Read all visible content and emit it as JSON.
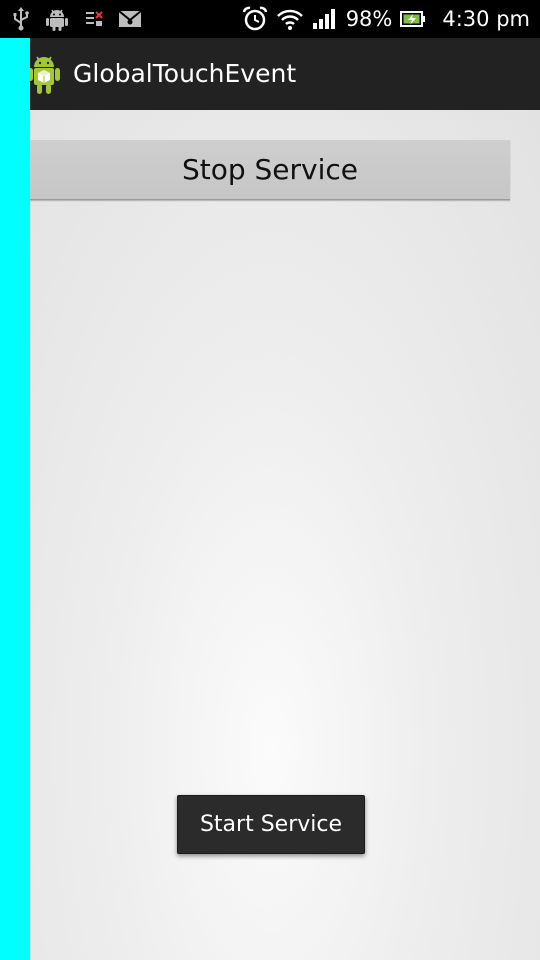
{
  "status_bar": {
    "left_icons": [
      "usb-icon",
      "android-debug-icon",
      "sim-icon",
      "email-icon"
    ],
    "right_icons": [
      "alarm-icon",
      "wifi-icon",
      "signal-icon",
      "battery-charging-icon"
    ],
    "battery": "98%",
    "time": "4:30 pm"
  },
  "action_bar": {
    "title": "GlobalTouchEvent",
    "icon": "android-app-icon"
  },
  "main": {
    "stop_button_label": "Stop Service"
  },
  "toast": {
    "text": "Start Service"
  },
  "colors": {
    "overlay_strip": "#00ffff",
    "action_bar_bg": "#222222",
    "status_bar_bg": "#000000",
    "button_bg": "#c9c9c9",
    "toast_bg": "#2b2b2b"
  }
}
